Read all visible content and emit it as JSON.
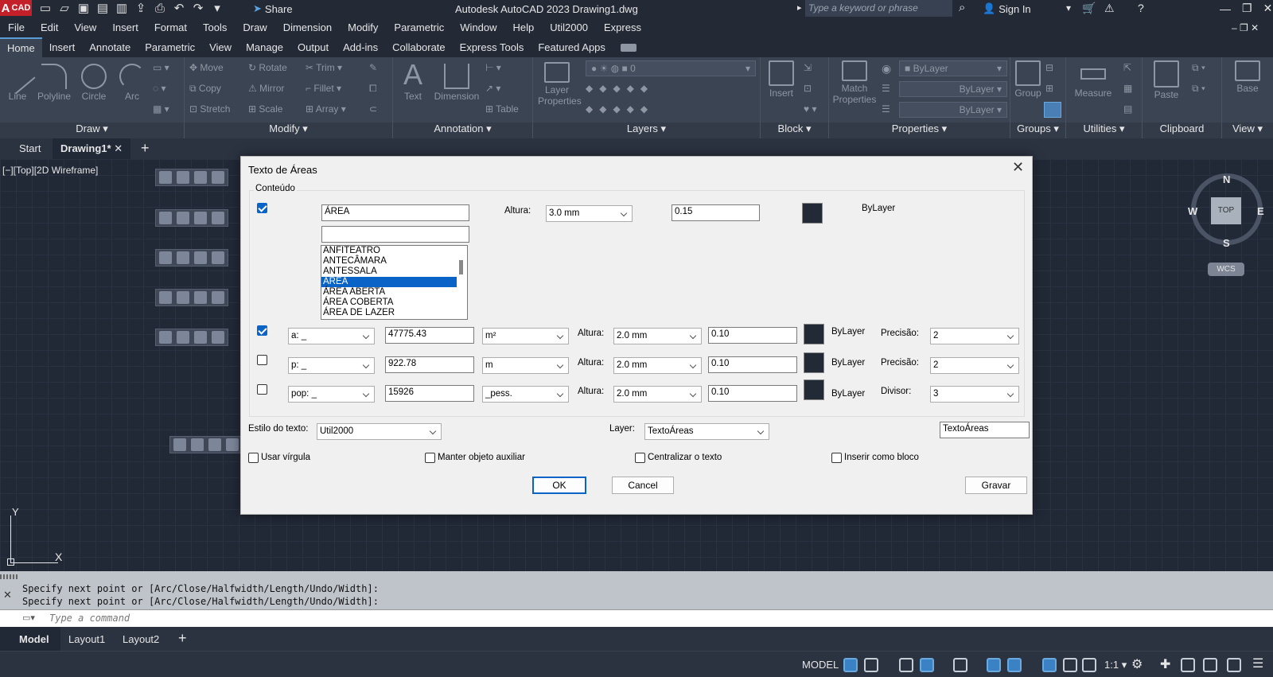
{
  "app": {
    "logo": "A",
    "logo_sub": "CAD",
    "title": "Autodesk AutoCAD 2023   Drawing1.dwg",
    "share": "Share",
    "search_placeholder": "Type a keyword or phrase",
    "sign_in": "Sign In"
  },
  "menu": [
    "File",
    "Edit",
    "View",
    "Insert",
    "Format",
    "Tools",
    "Draw",
    "Dimension",
    "Modify",
    "Parametric",
    "Window",
    "Help",
    "Util2000",
    "Express"
  ],
  "ribbon_tabs": [
    "Home",
    "Insert",
    "Annotate",
    "Parametric",
    "View",
    "Manage",
    "Output",
    "Add-ins",
    "Collaborate",
    "Express Tools",
    "Featured Apps"
  ],
  "ribbon": {
    "draw": {
      "title": "Draw",
      "tools": [
        "Line",
        "Polyline",
        "Circle",
        "Arc"
      ]
    },
    "modify": {
      "title": "Modify",
      "tools": [
        "Move",
        "Rotate",
        "Trim",
        "Copy",
        "Mirror",
        "Fillet",
        "Stretch",
        "Scale",
        "Array"
      ]
    },
    "annotation": {
      "title": "Annotation",
      "tools": [
        "Text",
        "Dimension",
        "Table"
      ]
    },
    "layers": {
      "title": "Layers",
      "tools": [
        "Layer",
        "Properties"
      ],
      "current": "0"
    },
    "block": {
      "title": "Block",
      "tools": [
        "Insert"
      ]
    },
    "properties": {
      "title": "Properties",
      "tools": [
        "Match",
        "Properties"
      ],
      "color": "ByLayer",
      "linetype": "ByLayer",
      "lineweight": "ByLayer"
    },
    "groups": {
      "title": "Groups",
      "tools": [
        "Group"
      ]
    },
    "utilities": {
      "title": "Utilities",
      "tools": [
        "Measure"
      ]
    },
    "clipboard": {
      "title": "Clipboard",
      "tools": [
        "Paste"
      ]
    },
    "view": {
      "title": "View",
      "tools": [
        "Base"
      ]
    }
  },
  "doc_tabs": {
    "start": "Start",
    "drawing": "Drawing1*"
  },
  "viewport": {
    "label": "[−][Top][2D Wireframe]",
    "compass": {
      "n": "N",
      "s": "S",
      "e": "E",
      "w": "W",
      "top": "TOP",
      "wcs": "WCS"
    },
    "ucs": {
      "x": "X",
      "y": "Y"
    }
  },
  "command": {
    "history": [
      "Specify next point or [Arc/Close/Halfwidth/Length/Undo/Width]:",
      "Specify next point or [Arc/Close/Halfwidth/Length/Undo/Width]:"
    ],
    "placeholder": "Type a command"
  },
  "layout_tabs": [
    "Model",
    "Layout1",
    "Layout2"
  ],
  "status": {
    "model": "MODEL",
    "scale": "1:1"
  },
  "dialog": {
    "title": "Texto de Áreas",
    "group_label": "Conteúdo",
    "name_value": "ÁREA",
    "name_filter": "",
    "altura_label": "Altura:",
    "altura_main": "3.0 mm",
    "factor_main": "0.15",
    "bylayer_main": "ByLayer",
    "list": [
      "ANFITEATRO",
      "ANTECÂMARA",
      "ANTESSALA",
      "ÁREA",
      "ÁREA ABERTA",
      "ÁREA COBERTA",
      "ÁREA DE LAZER"
    ],
    "rows": [
      {
        "checked": true,
        "prefix": "a: _",
        "value": "47775.43",
        "unit": "m²",
        "altura": "2.0 mm",
        "factor": "0.10",
        "bylayer": "ByLayer",
        "extra_label": "Precisão:",
        "extra_value": "2"
      },
      {
        "checked": false,
        "prefix": "p: _",
        "value": "922.78",
        "unit": "m",
        "altura": "2.0 mm",
        "factor": "0.10",
        "bylayer": "ByLayer",
        "extra_label": "Precisão:",
        "extra_value": "2"
      },
      {
        "checked": false,
        "prefix": "pop: _",
        "value": "15926",
        "unit": "_pess.",
        "altura": "2.0 mm",
        "factor": "0.10",
        "bylayer": "ByLayer",
        "extra_label": "Divisor:",
        "extra_value": "3"
      }
    ],
    "estilo_label": "Estilo do texto:",
    "estilo_value": "Util2000",
    "layer_label": "Layer:",
    "layer_value": "TextoÁreas",
    "layer_text": "TextoÁreas",
    "options": [
      "Usar vírgula",
      "Manter objeto auxiliar",
      "Centralizar o texto",
      "Inserir como bloco"
    ],
    "ok": "OK",
    "cancel": "Cancel",
    "save": "Gravar"
  }
}
